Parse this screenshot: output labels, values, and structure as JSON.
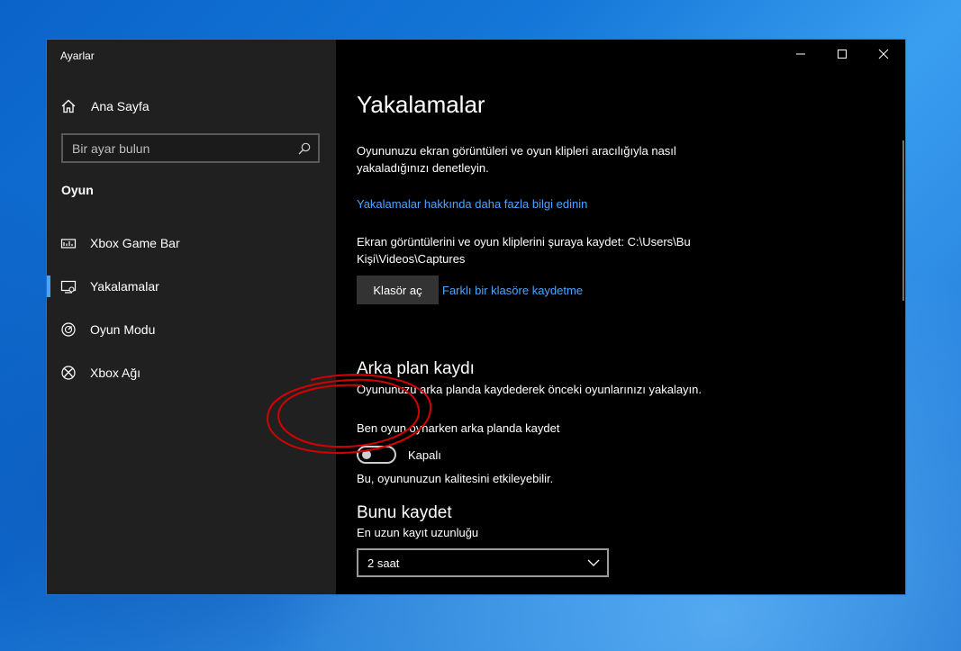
{
  "window": {
    "title": "Ayarlar"
  },
  "sidebar": {
    "home_label": "Ana Sayfa",
    "search_placeholder": "Bir ayar bulun",
    "section_title": "Oyun",
    "items": [
      {
        "label": "Xbox Game Bar",
        "icon": "gamebar-icon",
        "selected": false
      },
      {
        "label": "Yakalamalar",
        "icon": "captures-icon",
        "selected": true
      },
      {
        "label": "Oyun Modu",
        "icon": "game-mode-icon",
        "selected": false
      },
      {
        "label": "Xbox Ağı",
        "icon": "xbox-icon",
        "selected": false
      }
    ]
  },
  "main": {
    "title": "Yakalamalar",
    "description": "Oyununuzu ekran görüntüleri ve oyun klipleri aracılığıyla nasıl yakaladığınızı denetleyin.",
    "learn_more_link": "Yakalamalar hakkında daha fazla bilgi edinin",
    "save_location_text": "Ekran görüntülerini ve oyun kliplerini şuraya kaydet: C:\\Users\\Bu Kişi\\Videos\\Captures",
    "open_folder_button": "Klasör aç",
    "different_folder_link": "Farklı bir klasöre kaydetme",
    "background_recording": {
      "title": "Arka plan kaydı",
      "description": "Oyununuzu arka planda kaydederek önceki oyunlarınızı yakalayın.",
      "toggle_label": "Ben oyun oynarken arka planda kaydet",
      "toggle_state": "Kapalı",
      "toggle_on": false,
      "note": "Bu, oyununuzun kalitesini etkileyebilir."
    },
    "record_this": {
      "title": "Bunu kaydet",
      "duration_label": "En uzun kayıt uzunluğu",
      "duration_value": "2 saat"
    }
  },
  "colors": {
    "accent": "#4aa3ff",
    "link": "#4ea3ff",
    "annotation": "#d40000"
  }
}
